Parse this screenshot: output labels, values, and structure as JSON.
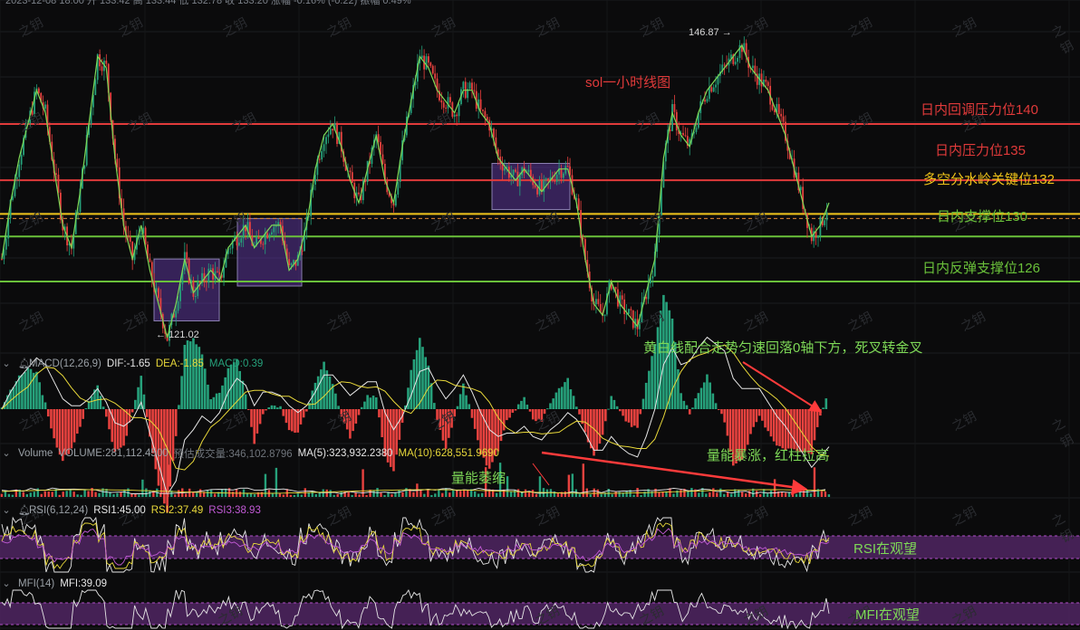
{
  "header": {
    "top_info": "2023-12-08 18:00  开 133.42  高 133.44  低 132.78  收 133.20  涨幅 -0.16% (-0.22)  振幅 0.49%"
  },
  "watermark": "之钥",
  "chart_title": "sol一小时线图",
  "price_markers": {
    "high": "146.87",
    "low": "121.02"
  },
  "levels": [
    {
      "label": "日内回调压力位140",
      "price": 140,
      "color": "#e03a3a"
    },
    {
      "label": "日内压力位135",
      "price": 135,
      "color": "#e03a3a"
    },
    {
      "label": "多空分水岭关键位132",
      "price": 132,
      "color": "#f0c419"
    },
    {
      "label": "日内支撑位130",
      "price": 130,
      "color": "#6ac13a"
    },
    {
      "label": "日内反弹支撑位126",
      "price": 126,
      "color": "#6ac13a"
    }
  ],
  "macd": {
    "title": "MACD(12,26,9)",
    "dif": "DIF:-1.65",
    "dea": "DEA:-1.85",
    "macd": "MACD:0.39",
    "annotation": "黄白线配合走势匀速回落0轴下方，死叉转金叉"
  },
  "volume": {
    "title": "Volume",
    "volume": "VOLUME:281,112.4500",
    "est": "预估成交量:346,102.8796",
    "ma5": "MA(5):323,932.2380",
    "ma10": "MA(10):628,551.9690",
    "annotation_left": "量能萎缩",
    "annotation_right": "量能暴涨，红柱拉高"
  },
  "rsi": {
    "title": "RSI(6,12,24)",
    "rsi1": "RSI1:45.00",
    "rsi2": "RSI2:37.49",
    "rsi3": "RSI3:38.93",
    "annotation": "RSI在观望"
  },
  "mfi": {
    "title": "MFI(14)",
    "mfi": "MFI:39.09",
    "annotation": "MFI在观望"
  },
  "colors": {
    "up": "#26a17b",
    "down": "#e8423f",
    "line": "#7ed957",
    "box": "#6a3fb5",
    "white_line": "#e6e6e6",
    "yellow_line": "#e8d83a",
    "purple_band": "#5a2a6e"
  },
  "chart_data": {
    "type": "line",
    "title": "sol一小时线图",
    "y_price_range": [
      119,
      149
    ],
    "series": [
      {
        "name": "price",
        "values": [
          128,
          133,
          137,
          140,
          143,
          141,
          136,
          131,
          129,
          134,
          140,
          146,
          145,
          137,
          131,
          128,
          131,
          127,
          124,
          121,
          124,
          128,
          125,
          126,
          127,
          126,
          129,
          130,
          131,
          129,
          130,
          131,
          131,
          127,
          128,
          131,
          136,
          139,
          140,
          138,
          135,
          133,
          136,
          139,
          135,
          133,
          138,
          142,
          146,
          145,
          143,
          142,
          141,
          143,
          143,
          141,
          140,
          137,
          136,
          135,
          136,
          135,
          134,
          135,
          136,
          136,
          133,
          128,
          124,
          123,
          126,
          124,
          123,
          122,
          125,
          128,
          137,
          141,
          139,
          138,
          141,
          143,
          144,
          145,
          146,
          147,
          145,
          144,
          143,
          141,
          139,
          136,
          133,
          130,
          131,
          133
        ]
      }
    ],
    "macd_annotation": "黄白线配合走势匀速回落0轴下方，死叉转金叉",
    "volume_annotations": [
      "量能萎缩",
      "量能暴涨，红柱拉高"
    ],
    "rsi_annotation": "RSI在观望",
    "mfi_annotation": "MFI在观望"
  }
}
